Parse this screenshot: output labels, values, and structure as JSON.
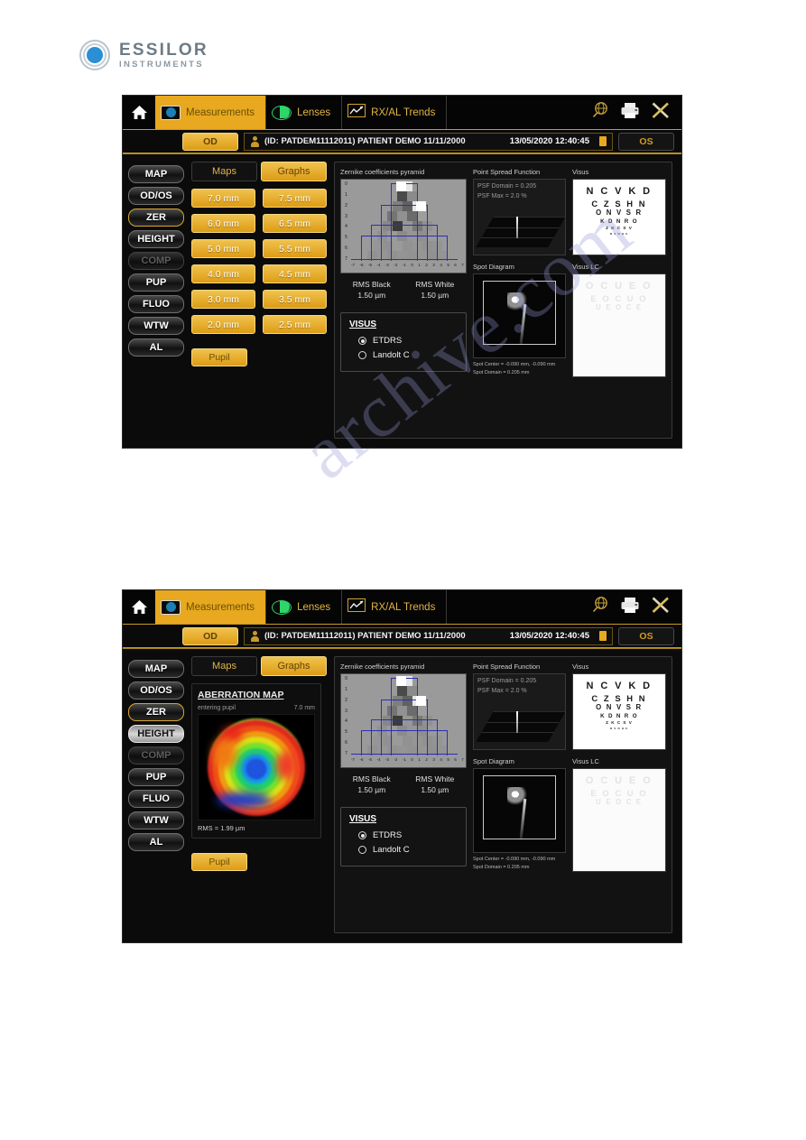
{
  "brand": {
    "name": "ESSILOR",
    "subtitle": "INSTRUMENTS",
    "logo_icon": "essilor-rings-logo"
  },
  "watermark": {
    "text": "archive.com"
  },
  "navbar": {
    "home_icon": "home-icon",
    "tabs": [
      {
        "label": "Measurements",
        "icon": "eye-boxed-icon",
        "active": true
      },
      {
        "label": "Lenses",
        "icon": "eye-green-icon",
        "active": false
      },
      {
        "label": "RX/AL Trends",
        "icon": "trend-chart-icon",
        "active": false
      }
    ],
    "icons": [
      {
        "name": "globe-search-icon"
      },
      {
        "name": "printer-icon"
      },
      {
        "name": "tools-icon"
      }
    ]
  },
  "patient_bar": {
    "od_label": "OD",
    "os_label": "OS",
    "person_icon": "person-icon",
    "patient_text": "(ID: PATDEM11112011) PATIENT DEMO 11/11/2000",
    "datetime": "13/05/2020 12:40:45",
    "battery_icon": "battery-icon"
  },
  "rail": {
    "items": [
      {
        "label": "MAP",
        "state": "normal"
      },
      {
        "label": "OD/OS",
        "state": "normal"
      },
      {
        "label": "ZER",
        "state": "selected"
      },
      {
        "label": "HEIGHT",
        "state": "normal"
      },
      {
        "label": "COMP",
        "state": "disabled"
      },
      {
        "label": "PUP",
        "state": "normal"
      },
      {
        "label": "FLUO",
        "state": "normal"
      },
      {
        "label": "WTW",
        "state": "normal"
      },
      {
        "label": "AL",
        "state": "normal"
      }
    ],
    "items_two": [
      {
        "label": "MAP",
        "state": "normal"
      },
      {
        "label": "OD/OS",
        "state": "normal"
      },
      {
        "label": "ZER",
        "state": "selected"
      },
      {
        "label": "HEIGHT",
        "state": "highlighted"
      },
      {
        "label": "COMP",
        "state": "disabled"
      },
      {
        "label": "PUP",
        "state": "normal"
      },
      {
        "label": "FLUO",
        "state": "normal"
      },
      {
        "label": "WTW",
        "state": "normal"
      },
      {
        "label": "AL",
        "state": "normal"
      }
    ]
  },
  "view_tabs": {
    "maps": "Maps",
    "graphs": "Graphs",
    "active": "Graphs"
  },
  "diameters": [
    "7.0 mm",
    "7.5 mm",
    "6.0 mm",
    "6.5 mm",
    "5.0 mm",
    "5.5 mm",
    "4.0 mm",
    "4.5 mm",
    "3.0 mm",
    "3.5 mm",
    "2.0 mm",
    "2.5 mm"
  ],
  "pupil_button": "Pupil",
  "aberration_map": {
    "title": "ABERRATION MAP",
    "sub_left": "entering pupil",
    "sub_right": "7.0 mm",
    "rms": "RMS = 1.99 µm"
  },
  "zernike": {
    "title": "Zernike coefficients pyramid",
    "y_ticks": [
      "0",
      "1",
      "2",
      "3",
      "4",
      "5",
      "6",
      "7"
    ],
    "x_ticks": [
      "-7",
      "-6",
      "-5",
      "-4",
      "-3",
      "-2",
      "-1",
      "0",
      "1",
      "2",
      "3",
      "4",
      "5",
      "6",
      "7"
    ]
  },
  "rms_values": {
    "black_label": "RMS Black",
    "black_value": "1.50 µm",
    "white_label": "RMS White",
    "white_value": "1.50 µm"
  },
  "visus_card": {
    "title": "VISUS",
    "options": [
      {
        "label": "ETDRS",
        "selected": true
      },
      {
        "label": "Landolt C",
        "selected": false
      }
    ]
  },
  "psf": {
    "title": "Point Spread Function",
    "domain": "PSF Domain = 0.205",
    "max": "PSF Max = 2.0 %"
  },
  "visus_panel": {
    "title": "Visus",
    "rows": [
      "N C V K D",
      "C Z S H N",
      "O N V S R",
      "K D N R O",
      "Z K C S V",
      "D V O H C"
    ]
  },
  "visus_lc_panel": {
    "title": "Visus LC",
    "rows": [
      "O C U E O",
      "E O C U O",
      "U E O C E"
    ]
  },
  "spot_diagram": {
    "title": "Spot Diagram",
    "center": "Spot Center = -0.090 mm, -0.090 mm",
    "domain": "Spot Domain = 0.205 mm"
  },
  "chart_data": {
    "type": "heatmap",
    "title": "Zernike coefficients pyramid",
    "xlabel": "",
    "ylabel": "",
    "x": [
      "-7",
      "-6",
      "-5",
      "-4",
      "-3",
      "-2",
      "-1",
      "0",
      "1",
      "2",
      "3",
      "4",
      "5",
      "6",
      "7"
    ],
    "y": [
      "0",
      "1",
      "2",
      "3",
      "4",
      "5",
      "6",
      "7"
    ],
    "note": "Pyramid of Zernike coefficient magnitudes rendered as grayscale cells; blue overlay traces RMS bar outlines per order.",
    "rows": [
      {
        "order": 0,
        "cells": [
          1.0
        ]
      },
      {
        "order": 1,
        "cells": [
          0.18,
          0.52
        ]
      },
      {
        "order": 2,
        "cells": [
          0.45,
          0.3,
          1.0
        ]
      },
      {
        "order": 3,
        "cells": [
          0.4,
          0.55,
          0.35,
          0.62
        ]
      },
      {
        "order": 4,
        "cells": [
          0.5,
          0.1,
          0.58,
          0.42,
          0.55
        ]
      },
      {
        "order": 5,
        "cells": [
          0.55,
          0.6,
          0.52,
          0.58,
          0.54,
          0.6
        ]
      },
      {
        "order": 6,
        "cells": [
          0.58,
          0.55,
          0.6,
          0.56,
          0.58,
          0.55,
          0.57
        ]
      },
      {
        "order": 7,
        "cells": [
          0.56,
          0.58,
          0.55,
          0.57,
          0.56,
          0.58,
          0.55,
          0.57
        ]
      }
    ]
  }
}
